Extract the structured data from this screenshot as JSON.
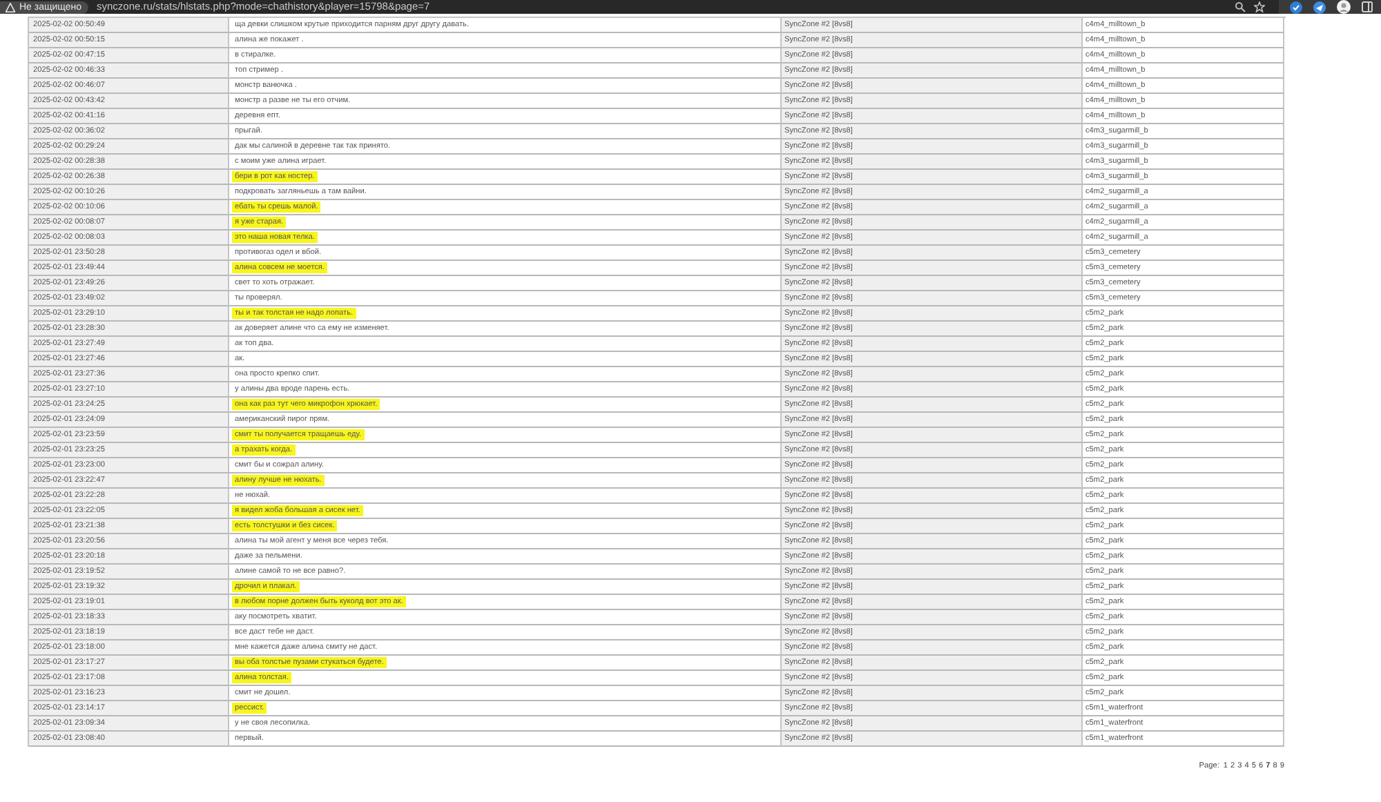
{
  "browser": {
    "security_label": "Не защищено",
    "url": "synczone.ru/stats/hlstats.php?mode=chathistory&player=15798&page=7"
  },
  "table": {
    "rows": [
      {
        "date": "2025-02-02 00:50:49",
        "message": "ща девки слишком крутые приходится парням друг другу давать.",
        "highlighted": false,
        "server": "SyncZone #2 [8vs8]",
        "map": "c4m4_milltown_b"
      },
      {
        "date": "2025-02-02 00:50:15",
        "message": "алина же покажет .",
        "highlighted": false,
        "server": "SyncZone #2 [8vs8]",
        "map": "c4m4_milltown_b"
      },
      {
        "date": "2025-02-02 00:47:15",
        "message": "в стиралке.",
        "highlighted": false,
        "server": "SyncZone #2 [8vs8]",
        "map": "c4m4_milltown_b"
      },
      {
        "date": "2025-02-02 00:46:33",
        "message": "топ стример .",
        "highlighted": false,
        "server": "SyncZone #2 [8vs8]",
        "map": "c4m4_milltown_b"
      },
      {
        "date": "2025-02-02 00:46:07",
        "message": "монстр ванючка .",
        "highlighted": false,
        "server": "SyncZone #2 [8vs8]",
        "map": "c4m4_milltown_b"
      },
      {
        "date": "2025-02-02 00:43:42",
        "message": "монстр а разве не ты его отчим.",
        "highlighted": false,
        "server": "SyncZone #2 [8vs8]",
        "map": "c4m4_milltown_b"
      },
      {
        "date": "2025-02-02 00:41:16",
        "message": "деревня епт.",
        "highlighted": false,
        "server": "SyncZone #2 [8vs8]",
        "map": "c4m4_milltown_b"
      },
      {
        "date": "2025-02-02 00:36:02",
        "message": "прыгай.",
        "highlighted": false,
        "server": "SyncZone #2 [8vs8]",
        "map": "c4m3_sugarmill_b"
      },
      {
        "date": "2025-02-02 00:29:24",
        "message": "дак мы салиной в деревне так так принято.",
        "highlighted": false,
        "server": "SyncZone #2 [8vs8]",
        "map": "c4m3_sugarmill_b"
      },
      {
        "date": "2025-02-02 00:28:38",
        "message": "с моим уже алина играет.",
        "highlighted": false,
        "server": "SyncZone #2 [8vs8]",
        "map": "c4m3_sugarmill_b"
      },
      {
        "date": "2025-02-02 00:26:38",
        "message": "бери в рот как ностер.",
        "highlighted": true,
        "server": "SyncZone #2 [8vs8]",
        "map": "c4m3_sugarmill_b"
      },
      {
        "date": "2025-02-02 00:10:26",
        "message": "подкровать загляньешь а там вайни.",
        "highlighted": false,
        "server": "SyncZone #2 [8vs8]",
        "map": "c4m2_sugarmill_a"
      },
      {
        "date": "2025-02-02 00:10:06",
        "message": "ебать ты срешь малой.",
        "highlighted": true,
        "server": "SyncZone #2 [8vs8]",
        "map": "c4m2_sugarmill_a"
      },
      {
        "date": "2025-02-02 00:08:07",
        "message": "я уже старая.",
        "highlighted": true,
        "server": "SyncZone #2 [8vs8]",
        "map": "c4m2_sugarmill_a"
      },
      {
        "date": "2025-02-02 00:08:03",
        "message": "это наша новая телка.",
        "highlighted": true,
        "server": "SyncZone #2 [8vs8]",
        "map": "c4m2_sugarmill_a"
      },
      {
        "date": "2025-02-01 23:50:28",
        "message": "противогаз одел и вбой.",
        "highlighted": false,
        "server": "SyncZone #2 [8vs8]",
        "map": "c5m3_cemetery"
      },
      {
        "date": "2025-02-01 23:49:44",
        "message": "алина совсем не моется.",
        "highlighted": true,
        "server": "SyncZone #2 [8vs8]",
        "map": "c5m3_cemetery"
      },
      {
        "date": "2025-02-01 23:49:26",
        "message": "свет то хоть отражает.",
        "highlighted": false,
        "server": "SyncZone #2 [8vs8]",
        "map": "c5m3_cemetery"
      },
      {
        "date": "2025-02-01 23:49:02",
        "message": "ты проверял.",
        "highlighted": false,
        "server": "SyncZone #2 [8vs8]",
        "map": "c5m3_cemetery"
      },
      {
        "date": "2025-02-01 23:29:10",
        "message": "ты и так толстая не надо лопать.",
        "highlighted": true,
        "server": "SyncZone #2 [8vs8]",
        "map": "c5m2_park"
      },
      {
        "date": "2025-02-01 23:28:30",
        "message": "ак доверяет алине что са ему не изменяет.",
        "highlighted": false,
        "server": "SyncZone #2 [8vs8]",
        "map": "c5m2_park"
      },
      {
        "date": "2025-02-01 23:27:49",
        "message": "ак топ два.",
        "highlighted": false,
        "server": "SyncZone #2 [8vs8]",
        "map": "c5m2_park"
      },
      {
        "date": "2025-02-01 23:27:46",
        "message": "ак.",
        "highlighted": false,
        "server": "SyncZone #2 [8vs8]",
        "map": "c5m2_park"
      },
      {
        "date": "2025-02-01 23:27:36",
        "message": "она просто крепко спит.",
        "highlighted": false,
        "server": "SyncZone #2 [8vs8]",
        "map": "c5m2_park"
      },
      {
        "date": "2025-02-01 23:27:10",
        "message": "у алины два вроде парень есть.",
        "highlighted": false,
        "server": "SyncZone #2 [8vs8]",
        "map": "c5m2_park"
      },
      {
        "date": "2025-02-01 23:24:25",
        "message": "она как раз тут чего микрофон хрюкает.",
        "highlighted": true,
        "server": "SyncZone #2 [8vs8]",
        "map": "c5m2_park"
      },
      {
        "date": "2025-02-01 23:24:09",
        "message": "американский пирог прям.",
        "highlighted": false,
        "server": "SyncZone #2 [8vs8]",
        "map": "c5m2_park"
      },
      {
        "date": "2025-02-01 23:23:59",
        "message": "смит ты получается тращаешь еду.",
        "highlighted": true,
        "server": "SyncZone #2 [8vs8]",
        "map": "c5m2_park"
      },
      {
        "date": "2025-02-01 23:23:25",
        "message": "а трахать когда.",
        "highlighted": true,
        "server": "SyncZone #2 [8vs8]",
        "map": "c5m2_park"
      },
      {
        "date": "2025-02-01 23:23:00",
        "message": "смит бы и сожрал алину.",
        "highlighted": false,
        "server": "SyncZone #2 [8vs8]",
        "map": "c5m2_park"
      },
      {
        "date": "2025-02-01 23:22:47",
        "message": "алину лучше не нюхать.",
        "highlighted": true,
        "server": "SyncZone #2 [8vs8]",
        "map": "c5m2_park"
      },
      {
        "date": "2025-02-01 23:22:28",
        "message": "не нюхай.",
        "highlighted": false,
        "server": "SyncZone #2 [8vs8]",
        "map": "c5m2_park"
      },
      {
        "date": "2025-02-01 23:22:05",
        "message": "я видел жоба большая а сисек нет.",
        "highlighted": true,
        "server": "SyncZone #2 [8vs8]",
        "map": "c5m2_park"
      },
      {
        "date": "2025-02-01 23:21:38",
        "message": "есть толстушки и без сисек.",
        "highlighted": true,
        "server": "SyncZone #2 [8vs8]",
        "map": "c5m2_park"
      },
      {
        "date": "2025-02-01 23:20:56",
        "message": "алина ты мой агент у меня все через тебя.",
        "highlighted": false,
        "server": "SyncZone #2 [8vs8]",
        "map": "c5m2_park"
      },
      {
        "date": "2025-02-01 23:20:18",
        "message": "даже за пельмени.",
        "highlighted": false,
        "server": "SyncZone #2 [8vs8]",
        "map": "c5m2_park"
      },
      {
        "date": "2025-02-01 23:19:52",
        "message": "алине самой то не все равно?.",
        "highlighted": false,
        "server": "SyncZone #2 [8vs8]",
        "map": "c5m2_park"
      },
      {
        "date": "2025-02-01 23:19:32",
        "message": "дрочил и плакал.",
        "highlighted": true,
        "server": "SyncZone #2 [8vs8]",
        "map": "c5m2_park"
      },
      {
        "date": "2025-02-01 23:19:01",
        "message": "в любом порне должен быть куколд вот это ак.",
        "highlighted": true,
        "server": "SyncZone #2 [8vs8]",
        "map": "c5m2_park"
      },
      {
        "date": "2025-02-01 23:18:33",
        "message": "аку посмотреть хватит.",
        "highlighted": false,
        "server": "SyncZone #2 [8vs8]",
        "map": "c5m2_park"
      },
      {
        "date": "2025-02-01 23:18:19",
        "message": "все даст тебе не даст.",
        "highlighted": false,
        "server": "SyncZone #2 [8vs8]",
        "map": "c5m2_park"
      },
      {
        "date": "2025-02-01 23:18:00",
        "message": "мне кажется даже алина смиту не даст.",
        "highlighted": false,
        "server": "SyncZone #2 [8vs8]",
        "map": "c5m2_park"
      },
      {
        "date": "2025-02-01 23:17:27",
        "message": "вы оба толстые пузами стукаться будете.",
        "highlighted": true,
        "server": "SyncZone #2 [8vs8]",
        "map": "c5m2_park"
      },
      {
        "date": "2025-02-01 23:17:08",
        "message": "алина толстая.",
        "highlighted": true,
        "server": "SyncZone #2 [8vs8]",
        "map": "c5m2_park"
      },
      {
        "date": "2025-02-01 23:16:23",
        "message": "смит не дошел.",
        "highlighted": false,
        "server": "SyncZone #2 [8vs8]",
        "map": "c5m2_park"
      },
      {
        "date": "2025-02-01 23:14:17",
        "message": "рессист.",
        "highlighted": true,
        "server": "SyncZone #2 [8vs8]",
        "map": "c5m1_waterfront"
      },
      {
        "date": "2025-02-01 23:09:34",
        "message": "у не своя лесопилка.",
        "highlighted": false,
        "server": "SyncZone #2 [8vs8]",
        "map": "c5m1_waterfront"
      },
      {
        "date": "2025-02-01 23:08:40",
        "message": "первый.",
        "highlighted": false,
        "server": "SyncZone #2 [8vs8]",
        "map": "c5m1_waterfront"
      }
    ]
  },
  "pagination": {
    "label": "Page:",
    "pages": [
      {
        "label": "1",
        "selected": false
      },
      {
        "label": "2",
        "selected": false
      },
      {
        "label": "3",
        "selected": false
      },
      {
        "label": "4",
        "selected": false
      },
      {
        "label": "5",
        "selected": false
      },
      {
        "label": "6",
        "selected": false
      },
      {
        "label": "7",
        "selected": true
      },
      {
        "label": "8",
        "selected": false
      },
      {
        "label": "9",
        "selected": false
      }
    ]
  }
}
